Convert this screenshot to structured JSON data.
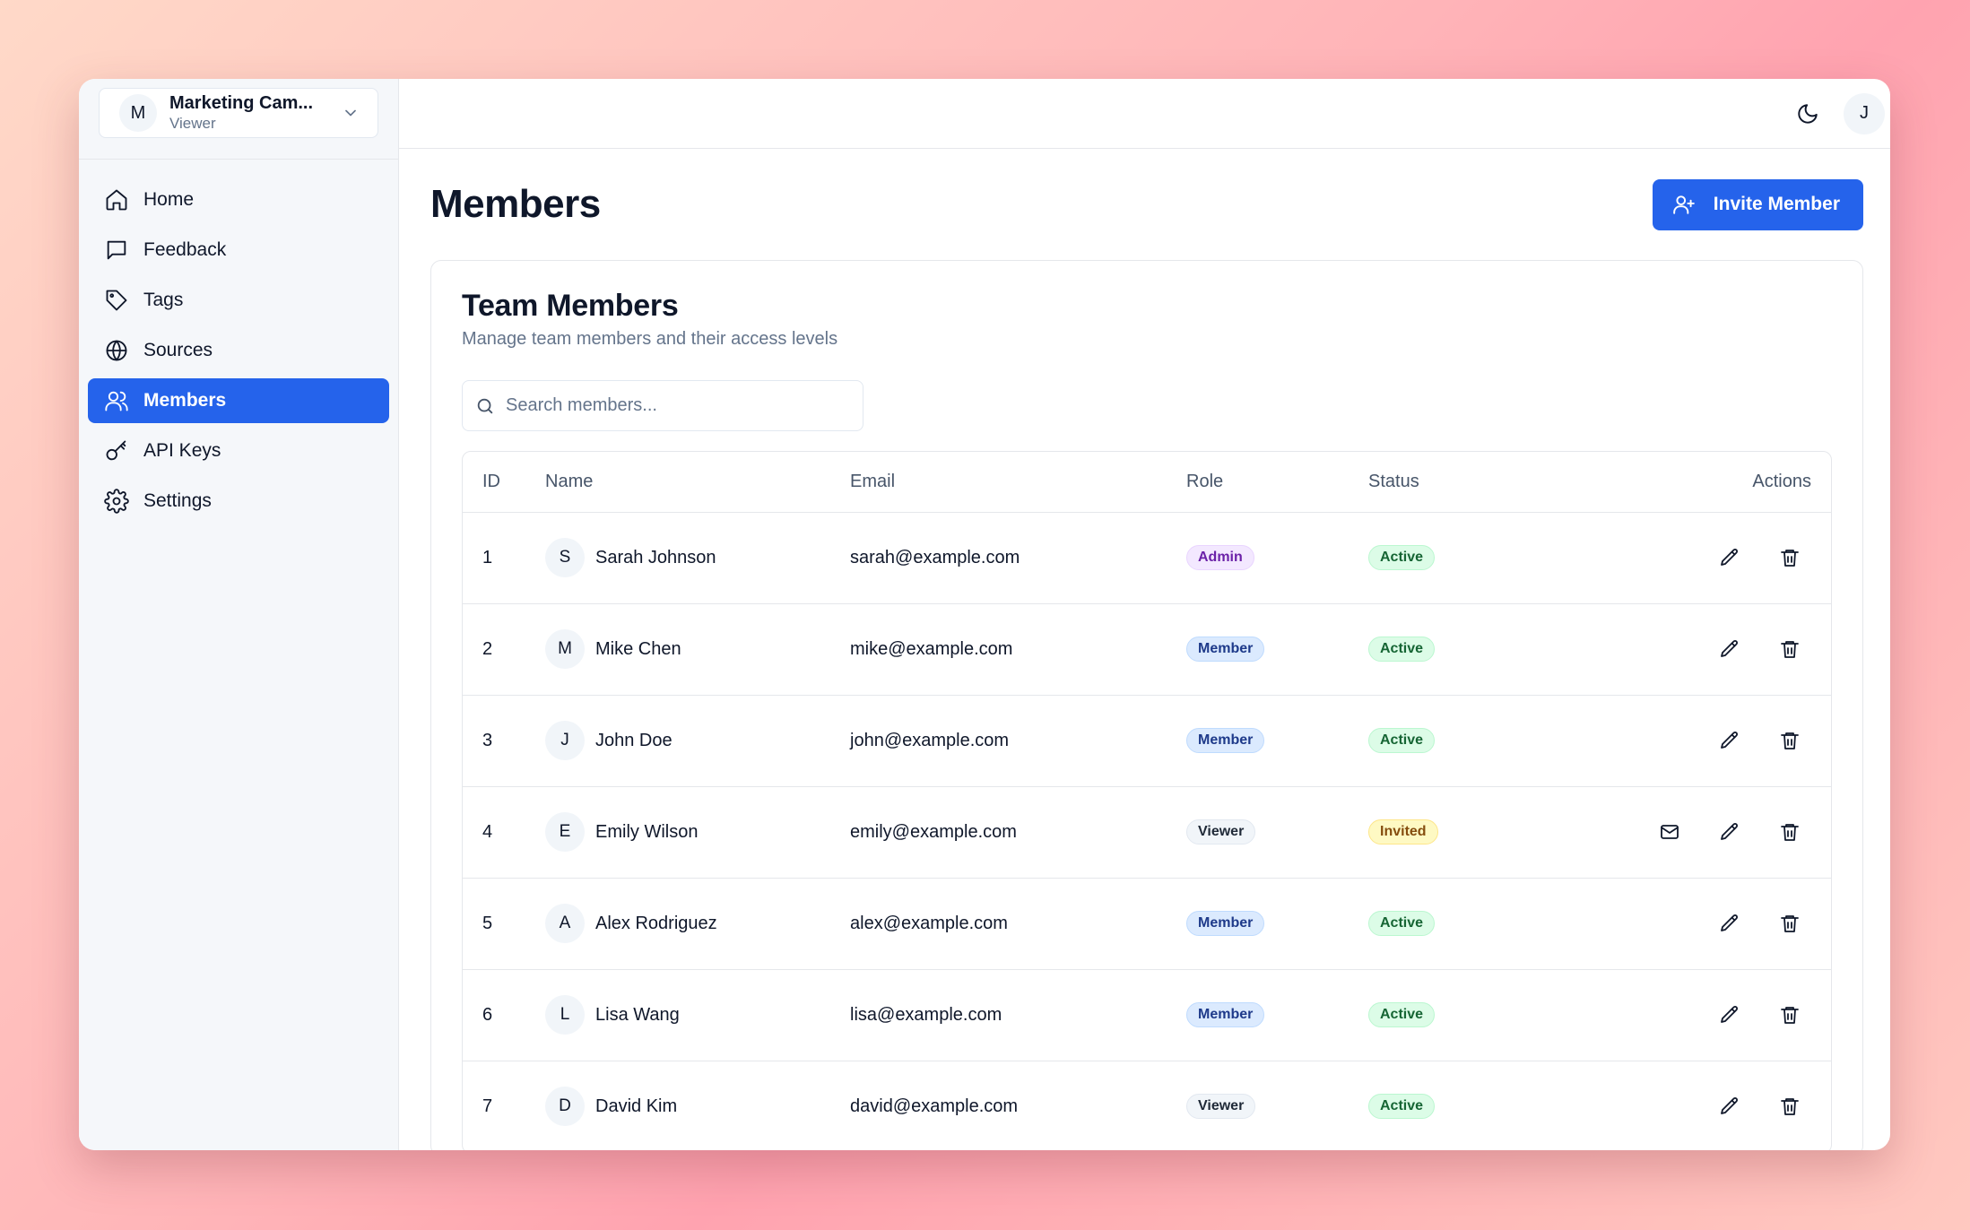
{
  "workspace": {
    "initial": "M",
    "name": "Marketing Cam...",
    "role": "Viewer"
  },
  "nav": [
    {
      "key": "home",
      "label": "Home",
      "icon": "home-icon",
      "active": false
    },
    {
      "key": "feedback",
      "label": "Feedback",
      "icon": "message-icon",
      "active": false
    },
    {
      "key": "tags",
      "label": "Tags",
      "icon": "tag-icon",
      "active": false
    },
    {
      "key": "sources",
      "label": "Sources",
      "icon": "globe-icon",
      "active": false
    },
    {
      "key": "members",
      "label": "Members",
      "icon": "users-icon",
      "active": true
    },
    {
      "key": "api-keys",
      "label": "API Keys",
      "icon": "key-icon",
      "active": false
    },
    {
      "key": "settings",
      "label": "Settings",
      "icon": "gear-icon",
      "active": false
    }
  ],
  "topbar": {
    "user_initial": "J",
    "theme_icon": "moon-icon"
  },
  "page": {
    "title": "Members",
    "invite_label": "Invite Member"
  },
  "card": {
    "title": "Team Members",
    "subtitle": "Manage team members and their access levels"
  },
  "search": {
    "placeholder": "Search members...",
    "value": ""
  },
  "table": {
    "columns": {
      "id": "ID",
      "name": "Name",
      "email": "Email",
      "role": "Role",
      "status": "Status",
      "actions": "Actions"
    },
    "rows": [
      {
        "id": "1",
        "initial": "S",
        "name": "Sarah Johnson",
        "email": "sarah@example.com",
        "role": "Admin",
        "status": "Active"
      },
      {
        "id": "2",
        "initial": "M",
        "name": "Mike Chen",
        "email": "mike@example.com",
        "role": "Member",
        "status": "Active"
      },
      {
        "id": "3",
        "initial": "J",
        "name": "John Doe",
        "email": "john@example.com",
        "role": "Member",
        "status": "Active"
      },
      {
        "id": "4",
        "initial": "E",
        "name": "Emily Wilson",
        "email": "emily@example.com",
        "role": "Viewer",
        "status": "Invited"
      },
      {
        "id": "5",
        "initial": "A",
        "name": "Alex Rodriguez",
        "email": "alex@example.com",
        "role": "Member",
        "status": "Active"
      },
      {
        "id": "6",
        "initial": "L",
        "name": "Lisa Wang",
        "email": "lisa@example.com",
        "role": "Member",
        "status": "Active"
      },
      {
        "id": "7",
        "initial": "D",
        "name": "David Kim",
        "email": "david@example.com",
        "role": "Viewer",
        "status": "Active"
      }
    ]
  },
  "colors": {
    "accent": "#2563eb",
    "sidebar_bg": "#f5f7fa"
  }
}
